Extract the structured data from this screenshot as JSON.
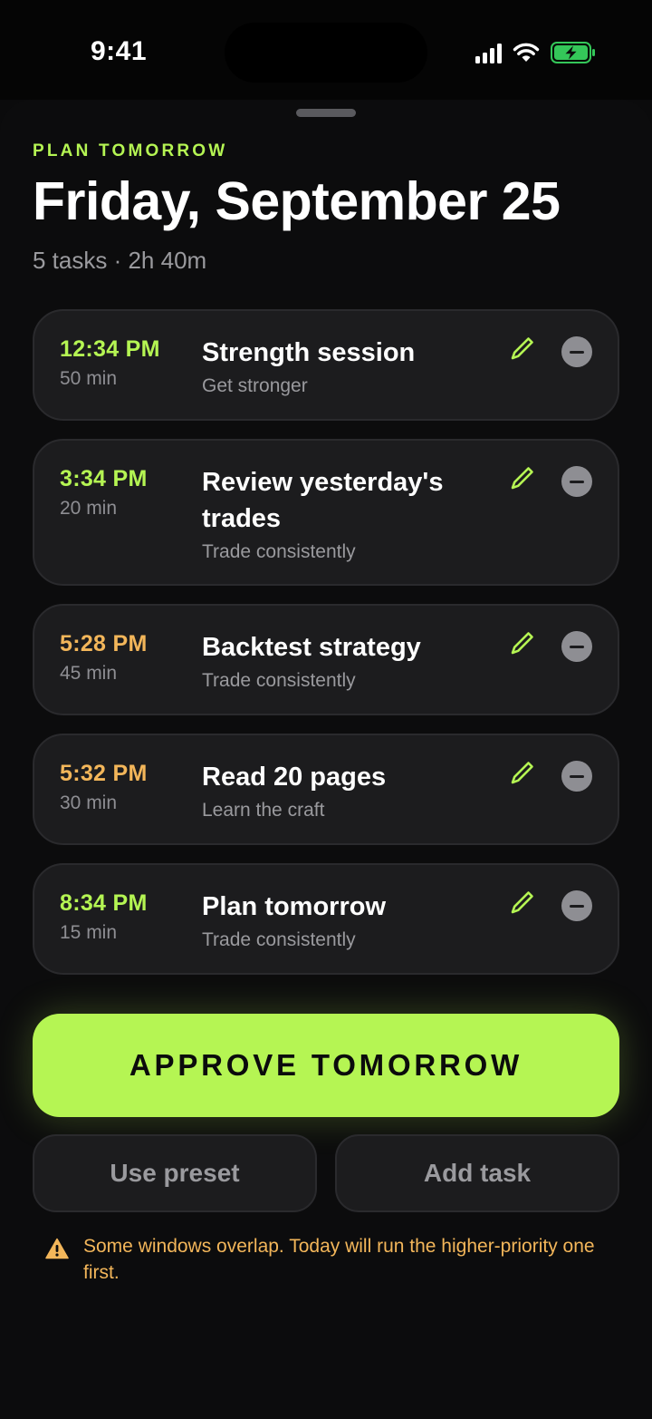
{
  "status_bar": {
    "time": "9:41"
  },
  "header": {
    "eyebrow": "PLAN TOMORROW",
    "title": "Friday, September 25",
    "summary": "5 tasks · 2h 40m"
  },
  "tasks": [
    {
      "time": "12:34 PM",
      "duration": "50 min",
      "title": "Strength session",
      "goal": "Get stronger",
      "time_color": "#b5f553"
    },
    {
      "time": "3:34 PM",
      "duration": "20 min",
      "title": "Review yesterday's trades",
      "goal": "Trade consistently",
      "time_color": "#b5f553"
    },
    {
      "time": "5:28 PM",
      "duration": "45 min",
      "title": "Backtest strategy",
      "goal": "Trade consistently",
      "time_color": "#f3b65a"
    },
    {
      "time": "5:32 PM",
      "duration": "30 min",
      "title": "Read 20 pages",
      "goal": "Learn the craft",
      "time_color": "#f3b65a"
    },
    {
      "time": "8:34 PM",
      "duration": "15 min",
      "title": "Plan tomorrow",
      "goal": "Trade consistently",
      "time_color": "#b5f553"
    }
  ],
  "actions": {
    "approve_label": "APPROVE TOMORROW",
    "preset_label": "Use preset",
    "add_task_label": "Add task"
  },
  "warning": {
    "icon": "warning-triangle-icon",
    "text": "Some windows overlap. Today will run the higher-priority one first."
  },
  "colors": {
    "accent": "#b5f553",
    "warning": "#f3b65a",
    "card": "#1c1c1e",
    "background": "#0c0c0d"
  }
}
